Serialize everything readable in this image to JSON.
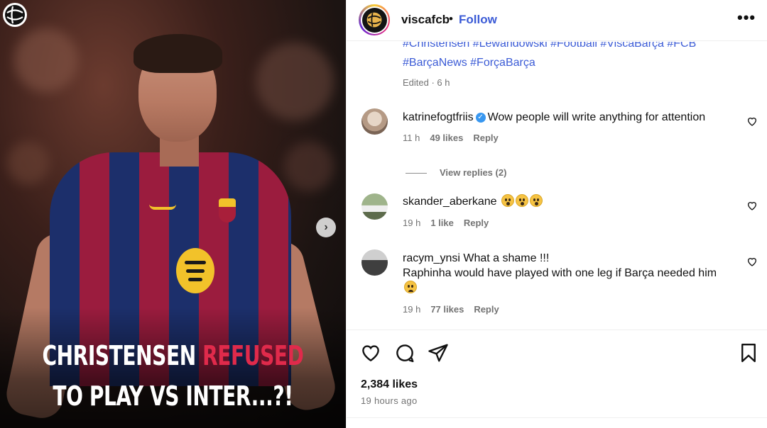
{
  "media": {
    "headline_white_1": "CHRISTENSEN ",
    "headline_red": "REFUSED",
    "headline_line2": "TO PLAY VS INTER...?!"
  },
  "header": {
    "username": "viscafcb",
    "separator": "•",
    "follow_label": "Follow",
    "more_label": "•••"
  },
  "caption": {
    "hashtags_row1": "#Christensen #Lewandowski #Football #ViscaBarça #FCB",
    "hashtags_row2": "#BarçaNews #ForçaBarça",
    "edited": "Edited · 6 h"
  },
  "comments": [
    {
      "username": "katrinefogtfriis",
      "verified": true,
      "text": "Wow people will write anything for attention",
      "time": "11 h",
      "likes": "49 likes",
      "reply": "Reply",
      "view_replies": "View replies (2)"
    },
    {
      "username": "skander_aberkane",
      "text": "",
      "emojis": [
        "astonished-emoji",
        "astonished-emoji",
        "astonished-emoji"
      ],
      "time": "19 h",
      "likes": "1 like",
      "reply": "Reply"
    },
    {
      "username": "racym_ynsi",
      "text": "What a shame !!!",
      "text_line2": "Raphinha would have played with one leg if Barça needed him",
      "emojis": [
        "sad-emoji"
      ],
      "time": "19 h",
      "likes": "77 likes",
      "reply": "Reply"
    }
  ],
  "footer": {
    "likes": "2,384 likes",
    "time": "19 hours ago"
  },
  "colors": {
    "link_blue": "#3b5bd6",
    "headline_red": "#e02a4b",
    "muted": "#737373"
  }
}
